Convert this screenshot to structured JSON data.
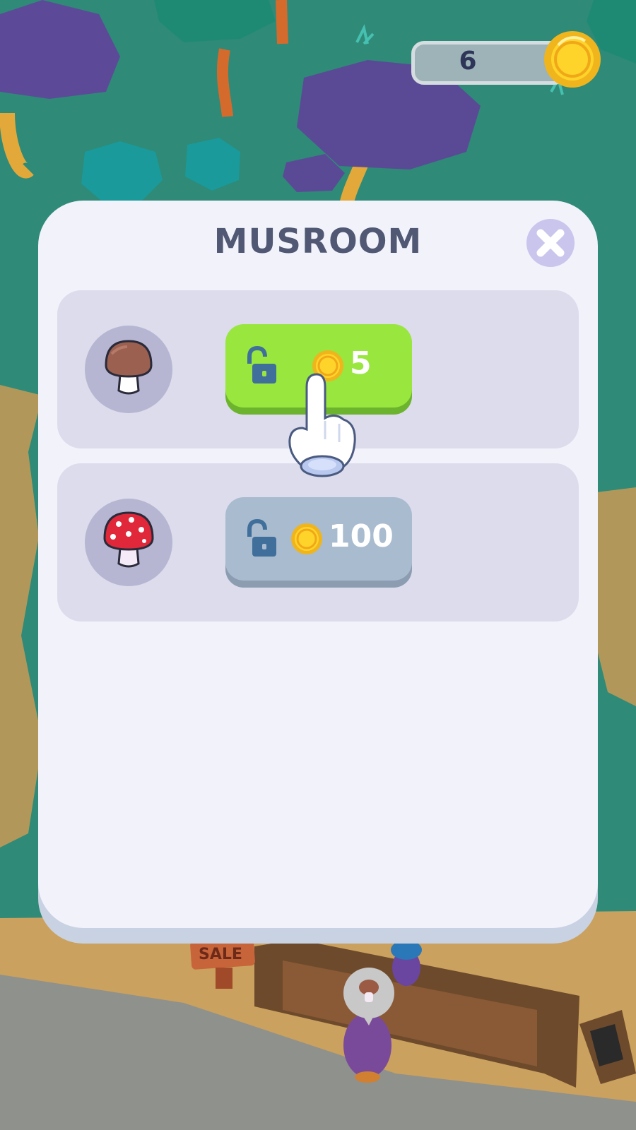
{
  "hud": {
    "coin_count": "6",
    "coin_icon": "gold-coin-icon"
  },
  "modal": {
    "title": "MUSROOM",
    "close_icon": "close-x-icon",
    "items": [
      {
        "icon": "brown-mushroom-icon",
        "lock_icon": "unlocked-padlock-icon",
        "coin_icon": "gold-coin-icon",
        "price": "5",
        "button_color": "#98e63e",
        "state": "affordable"
      },
      {
        "icon": "red-spotted-mushroom-icon",
        "lock_icon": "unlocked-padlock-icon",
        "coin_icon": "gold-coin-icon",
        "price": "100",
        "button_color": "#a9bbcf",
        "state": "unaffordable"
      }
    ]
  },
  "tutorial": {
    "pointer_icon": "tap-hand-icon"
  },
  "scene": {
    "sign_text": "SALE",
    "customer_request_icon": "mushroom-speech-bubble-icon"
  },
  "colors": {
    "panel": "#f2f2fb",
    "row": "#dcdcec",
    "title": "#505873",
    "grass": "#2f8a78",
    "path": "#c89a55"
  }
}
